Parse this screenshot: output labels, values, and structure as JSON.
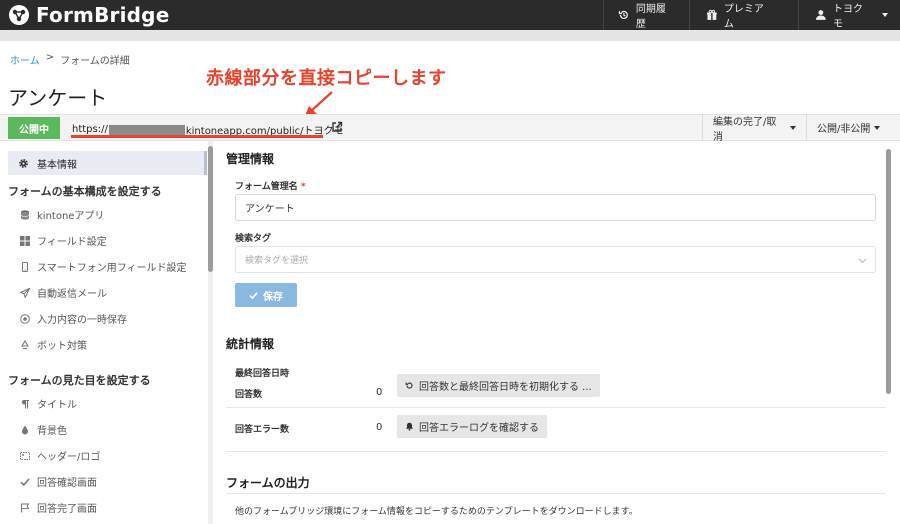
{
  "app": {
    "name": "FormBridge",
    "nav": [
      {
        "label": "同期履歴",
        "icon": "history-icon"
      },
      {
        "label": "プレミアム",
        "icon": "gift-icon"
      },
      {
        "label": "トヨクモ",
        "icon": "user-icon"
      }
    ]
  },
  "breadcrumb": {
    "home": "ホーム",
    "separator": ">",
    "current": "フォームの詳細"
  },
  "page": {
    "title": "アンケート"
  },
  "annotation": {
    "text": "赤線部分を直接コピーします"
  },
  "urlbar": {
    "status": "公開中",
    "url_prefix": "https://",
    "url_suffix": "kintoneapp.com/public/トヨクモ",
    "edit_menu": "編集の完了/取消",
    "publish_menu": "公開/非公開"
  },
  "sidebar": {
    "active": {
      "label": "基本情報",
      "icon": "gear-icon"
    },
    "group1_heading": "フォームの基本構成を設定する",
    "group1": [
      {
        "label": "kintoneアプリ",
        "icon": "database-icon"
      },
      {
        "label": "フィールド設定",
        "icon": "grid-icon"
      },
      {
        "label": "スマートフォン用フィールド設定",
        "icon": "smartphone-icon"
      },
      {
        "label": "自動返信メール",
        "icon": "send-icon"
      },
      {
        "label": "入力内容の一時保存",
        "icon": "save-icon"
      },
      {
        "label": "ボット対策",
        "icon": "recycle-icon"
      }
    ],
    "group2_heading": "フォームの見た目を設定する",
    "group2": [
      {
        "label": "タイトル",
        "icon": "paragraph-icon"
      },
      {
        "label": "背景色",
        "icon": "droplet-icon"
      },
      {
        "label": "ヘッダー/ロゴ",
        "icon": "image-icon"
      },
      {
        "label": "回答確認画面",
        "icon": "check-icon"
      },
      {
        "label": "回答完了画面",
        "icon": "flag-icon"
      }
    ]
  },
  "management": {
    "title": "管理情報",
    "name_label": "フォーム管理名",
    "required_mark": "*",
    "name_value": "アンケート",
    "tag_label": "検索タグ",
    "tag_placeholder": "検索タグを選択",
    "save_label": "保存"
  },
  "stats": {
    "title": "統計情報",
    "last_answer_label": "最終回答日時",
    "answer_count_label": "回答数",
    "answer_count_value": "0",
    "reset_label": "回答数と最終回答日時を初期化する ...",
    "error_count_label": "回答エラー数",
    "error_count_value": "0",
    "error_log_label": "回答エラーログを確認する"
  },
  "output": {
    "title": "フォームの出力",
    "description": "他のフォームブリッジ環境にフォーム情報をコピーするためのテンプレートをダウンロードします。"
  },
  "colors": {
    "accent": "#3b8ed6",
    "status_green": "#5cb85c",
    "annotation_red": "#e8412c",
    "save_button": "#8bb8e0",
    "topbar": "#2b2b2b"
  }
}
